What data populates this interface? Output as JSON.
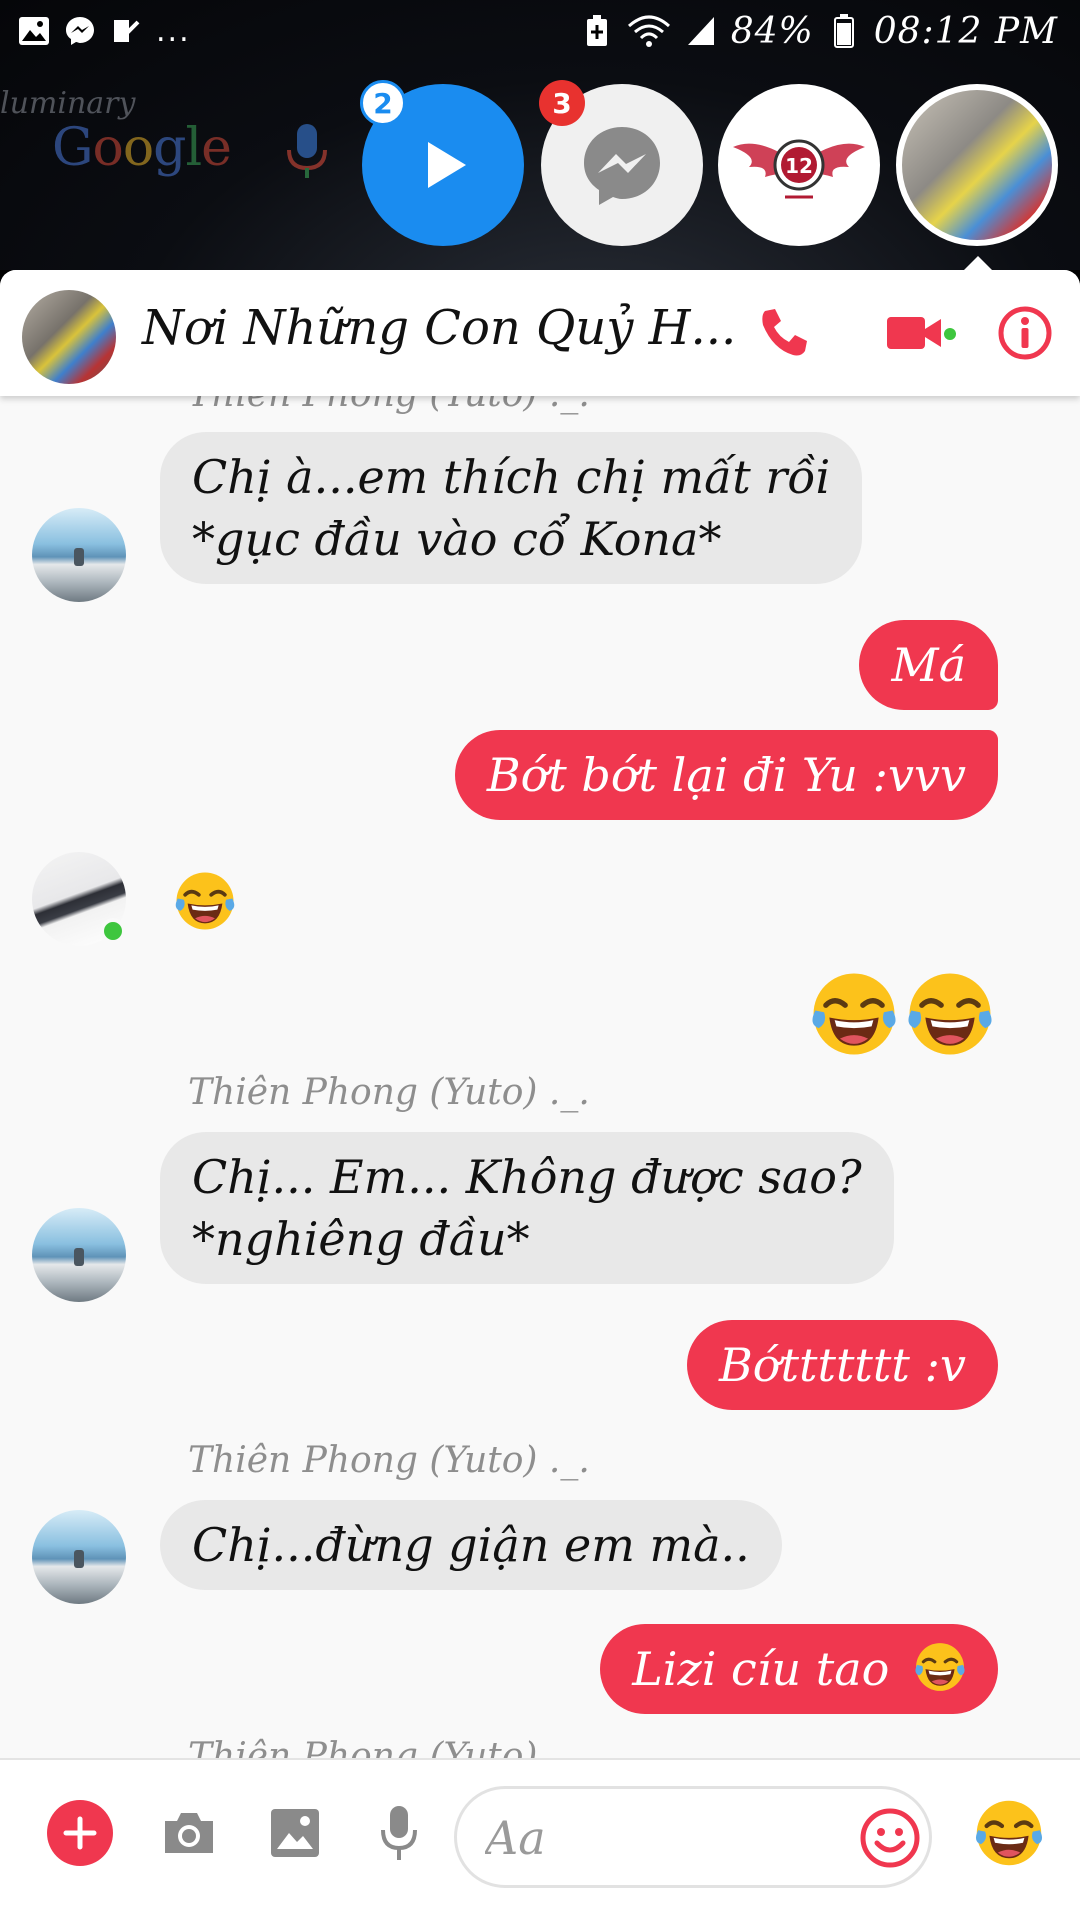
{
  "status_bar": {
    "battery": "84%",
    "time": "08:12 PM",
    "more": "..."
  },
  "wallpaper": {
    "widget_text": "luminary",
    "google_logo": [
      "G",
      "o",
      "o",
      "g",
      "l",
      "e"
    ]
  },
  "chat_heads": {
    "video_badge": "2",
    "messenger_badge": "3",
    "logo_text": "12"
  },
  "header": {
    "title": "Nơi Những Con Quỷ H..."
  },
  "messages": {
    "partial_top_name": "Thiên Phong (Yuto) ._.",
    "m1": [
      "Chị à...em thích chị mất rồi",
      "*gục đầu vào cổ Kona*"
    ],
    "m2": "Má",
    "m3": "Bớt bớt lại đi Yu :vvv",
    "name2": "Thiên Phong (Yuto) ._.",
    "m6": [
      "Chị... Em... Không được sao?",
      "*nghiêng đầu*"
    ],
    "m7": "Bớttttttt :v",
    "name3": "Thiên Phong (Yuto) ._.",
    "m8": "Chị...đừng giận em mà..",
    "m9": "Lizi cíu tao",
    "partial_bottom_name": "Thiên Phong (Yuto)"
  },
  "composer": {
    "placeholder": "Aa"
  },
  "colors": {
    "accent": "#f0374f",
    "incoming_bubble": "#e8e8e8",
    "messenger_blue": "#1a8cf0",
    "online": "#3ec63e"
  },
  "icons": {
    "emoji_laugh": "face-with-tears-of-joy",
    "call": "phone-icon",
    "video": "video-camera-icon",
    "info": "info-icon"
  }
}
